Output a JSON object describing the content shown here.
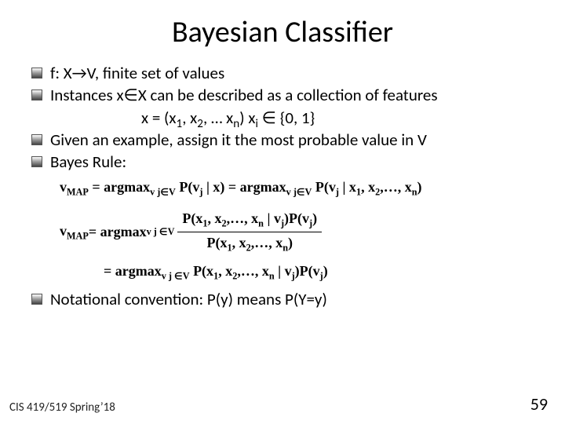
{
  "title": "Bayesian Classifier",
  "bullets": {
    "b1": "f: X→V,  finite set of values",
    "b2": "Instances x∈X can be described as a collection of features",
    "b2_line2_pre": "x = (x",
    "b2_line2_mid": ", x",
    "b2_line2_mid2": ", … x",
    "b2_line2_post": ")    x",
    "b2_line2_tail": " ∈ {0, 1}",
    "b3": "Given an example, assign it the most probable value in V",
    "b4": "Bayes Rule:",
    "b5": "Notational convention: P(y) means P(Y=y)"
  },
  "subs": {
    "one": "1",
    "two": "2",
    "n": "n",
    "i": "i",
    "j": "j",
    "map": "MAP",
    "vjv": "v j ∈V",
    "vjinv": "v j∈V"
  },
  "eq": {
    "e1_lhs": "v",
    "e1_eq": " = argmax",
    "e1_p1": " P(v",
    "e1_p1b": " | x) = argmax",
    "e1_p2": " P(v",
    "e1_p2b": " | x",
    "e1_p2c": ", x",
    "e1_p2d": ",…, x",
    "e1_p2e": ")",
    "e2_lhs": "v",
    "e2_eq": "  =   argmax",
    "e2_num_a": "P(x",
    "e2_num_b": ", x",
    "e2_num_c": ",…, x",
    "e2_num_d": " | v",
    "e2_num_e": ")P(v",
    "e2_num_f": ")",
    "e2_den_a": "P(x",
    "e2_den_b": ", x",
    "e2_den_c": ",…, x",
    "e2_den_d": ")",
    "e3_eq": "=   argmax",
    "e3_a": "P(x",
    "e3_b": ", x",
    "e3_c": ",…, x",
    "e3_d": " | v",
    "e3_e": ")P(v",
    "e3_f": ")"
  },
  "footer": {
    "left": "CIS 419/519 Spring’18",
    "right": "59"
  }
}
